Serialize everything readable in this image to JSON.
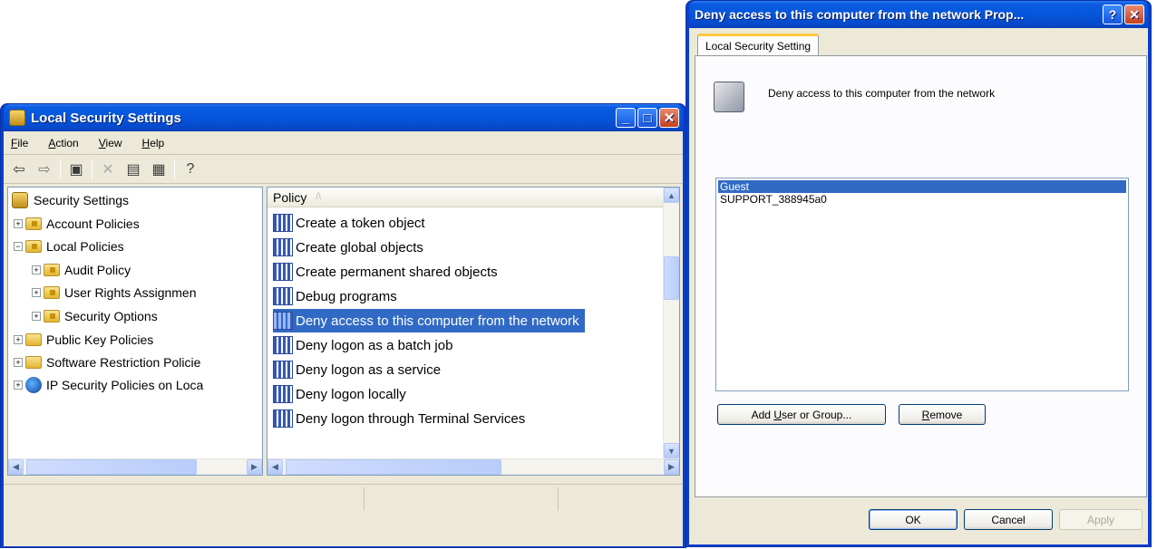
{
  "lss_window": {
    "title": "Local Security Settings",
    "menu": [
      {
        "pre": "",
        "key": "F",
        "post": "ile"
      },
      {
        "pre": "",
        "key": "A",
        "post": "ction"
      },
      {
        "pre": "",
        "key": "V",
        "post": "iew"
      },
      {
        "pre": "",
        "key": "H",
        "post": "elp"
      }
    ],
    "toolbar": [
      "back-arrow-icon",
      "forward-arrow-icon",
      "up-folder-icon",
      "delete-icon",
      "properties-icon",
      "export-list-icon",
      "help-icon"
    ],
    "tree": {
      "root": "Security Settings",
      "account_policies": "Account Policies",
      "local_policies": "Local Policies",
      "audit_policy": "Audit Policy",
      "user_rights": "User Rights Assignmen",
      "security_options": "Security Options",
      "public_key": "Public Key Policies",
      "software_restriction": "Software Restriction Policie",
      "ip_security": "IP Security Policies on Loca"
    },
    "list": {
      "column": "Policy",
      "sort_glyph": "/\\",
      "items": [
        "Create a token object",
        "Create global objects",
        "Create permanent shared objects",
        "Debug programs",
        "Deny access to this computer from the network",
        "Deny logon as a batch job",
        "Deny logon as a service",
        "Deny logon locally",
        "Deny logon through Terminal Services"
      ],
      "selected_index": 4
    }
  },
  "dialog": {
    "title": "Deny access to this computer from the network Prop...",
    "tab": "Local Security Setting",
    "description": "Deny access to this computer from the network",
    "accounts": [
      "Guest",
      "SUPPORT_388945a0"
    ],
    "selected_account": 0,
    "add_button": {
      "pre": "Add ",
      "key": "U",
      "post": "ser or Group..."
    },
    "remove_button": {
      "pre": "",
      "key": "R",
      "post": "emove"
    },
    "ok": "OK",
    "cancel": "Cancel",
    "apply": "Apply"
  },
  "colors": {
    "titlebar": "#0656db",
    "selection": "#316ac5",
    "dialog_bg": "#ece9d8"
  }
}
